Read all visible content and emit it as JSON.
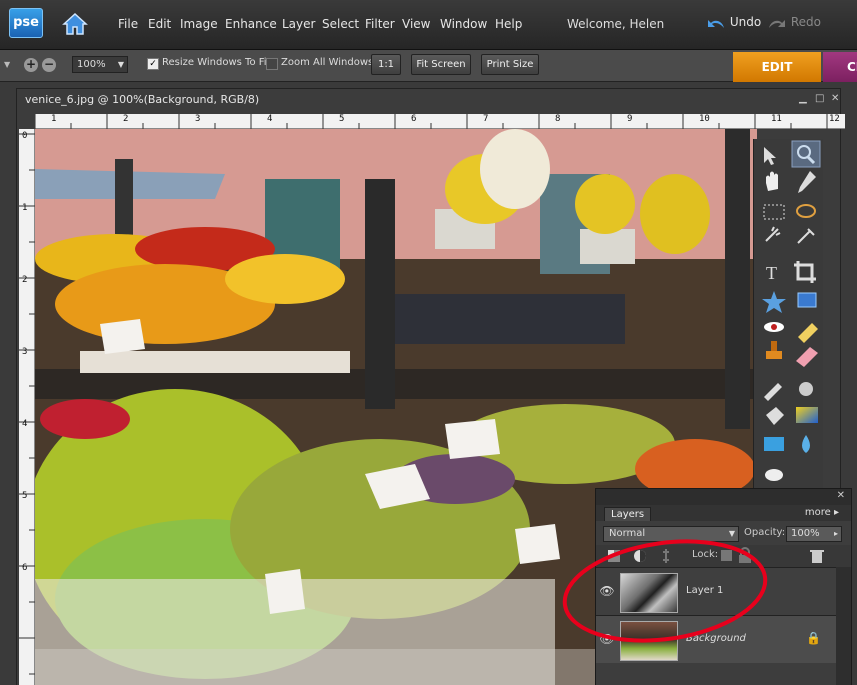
{
  "app": {
    "logo": "pse",
    "welcome": "Welcome, Helen"
  },
  "menu": [
    "File",
    "Edit",
    "Image",
    "Enhance",
    "Layer",
    "Select",
    "Filter",
    "View",
    "Window",
    "Help"
  ],
  "history": {
    "undo": "Undo",
    "redo": "Redo"
  },
  "options": {
    "zoom": "100%",
    "resize_label": "Resize Windows To Fit",
    "zoom_all_label": "Zoom All Windows",
    "one_to_one": "1:1",
    "fit_screen": "Fit Screen",
    "print_size": "Print Size"
  },
  "mode_tabs": {
    "edit": "EDIT",
    "create": "CR"
  },
  "document": {
    "title": "venice_6.jpg @ 100%(Background, RGB/8)",
    "ruler_h": [
      "1",
      "2",
      "3",
      "4",
      "5",
      "6",
      "7",
      "8",
      "9",
      "10",
      "11",
      "12"
    ],
    "ruler_v": [
      "0",
      "1",
      "2",
      "3",
      "4",
      "5",
      "6"
    ]
  },
  "tools": [
    "move-tool",
    "zoom-tool",
    "hand-tool",
    "eyedropper-tool",
    "rect-marquee-tool",
    "lasso-tool",
    "magic-wand-tool",
    "quick-selection-tool",
    "type-tool",
    "crop-tool",
    "custom-shape-tool",
    "cookie-cutter-tool",
    "red-eye-tool",
    "healing-brush-tool",
    "clone-stamp-tool",
    "eraser-tool",
    "brush-tool",
    "smart-brush-tool",
    "paint-bucket-tool",
    "gradient-tool",
    "shape-tool",
    "blur-tool",
    "sponge-tool"
  ],
  "layers_panel": {
    "tab": "Layers",
    "more": "more",
    "blend_mode": "Normal",
    "opacity_label": "Opacity:",
    "opacity": "100%",
    "lock_label": "Lock:",
    "layers": [
      {
        "name": "Layer 1",
        "visible": true
      },
      {
        "name": "Background",
        "visible": true,
        "locked": true
      }
    ]
  },
  "annotation": {
    "color": "#e8001c"
  }
}
